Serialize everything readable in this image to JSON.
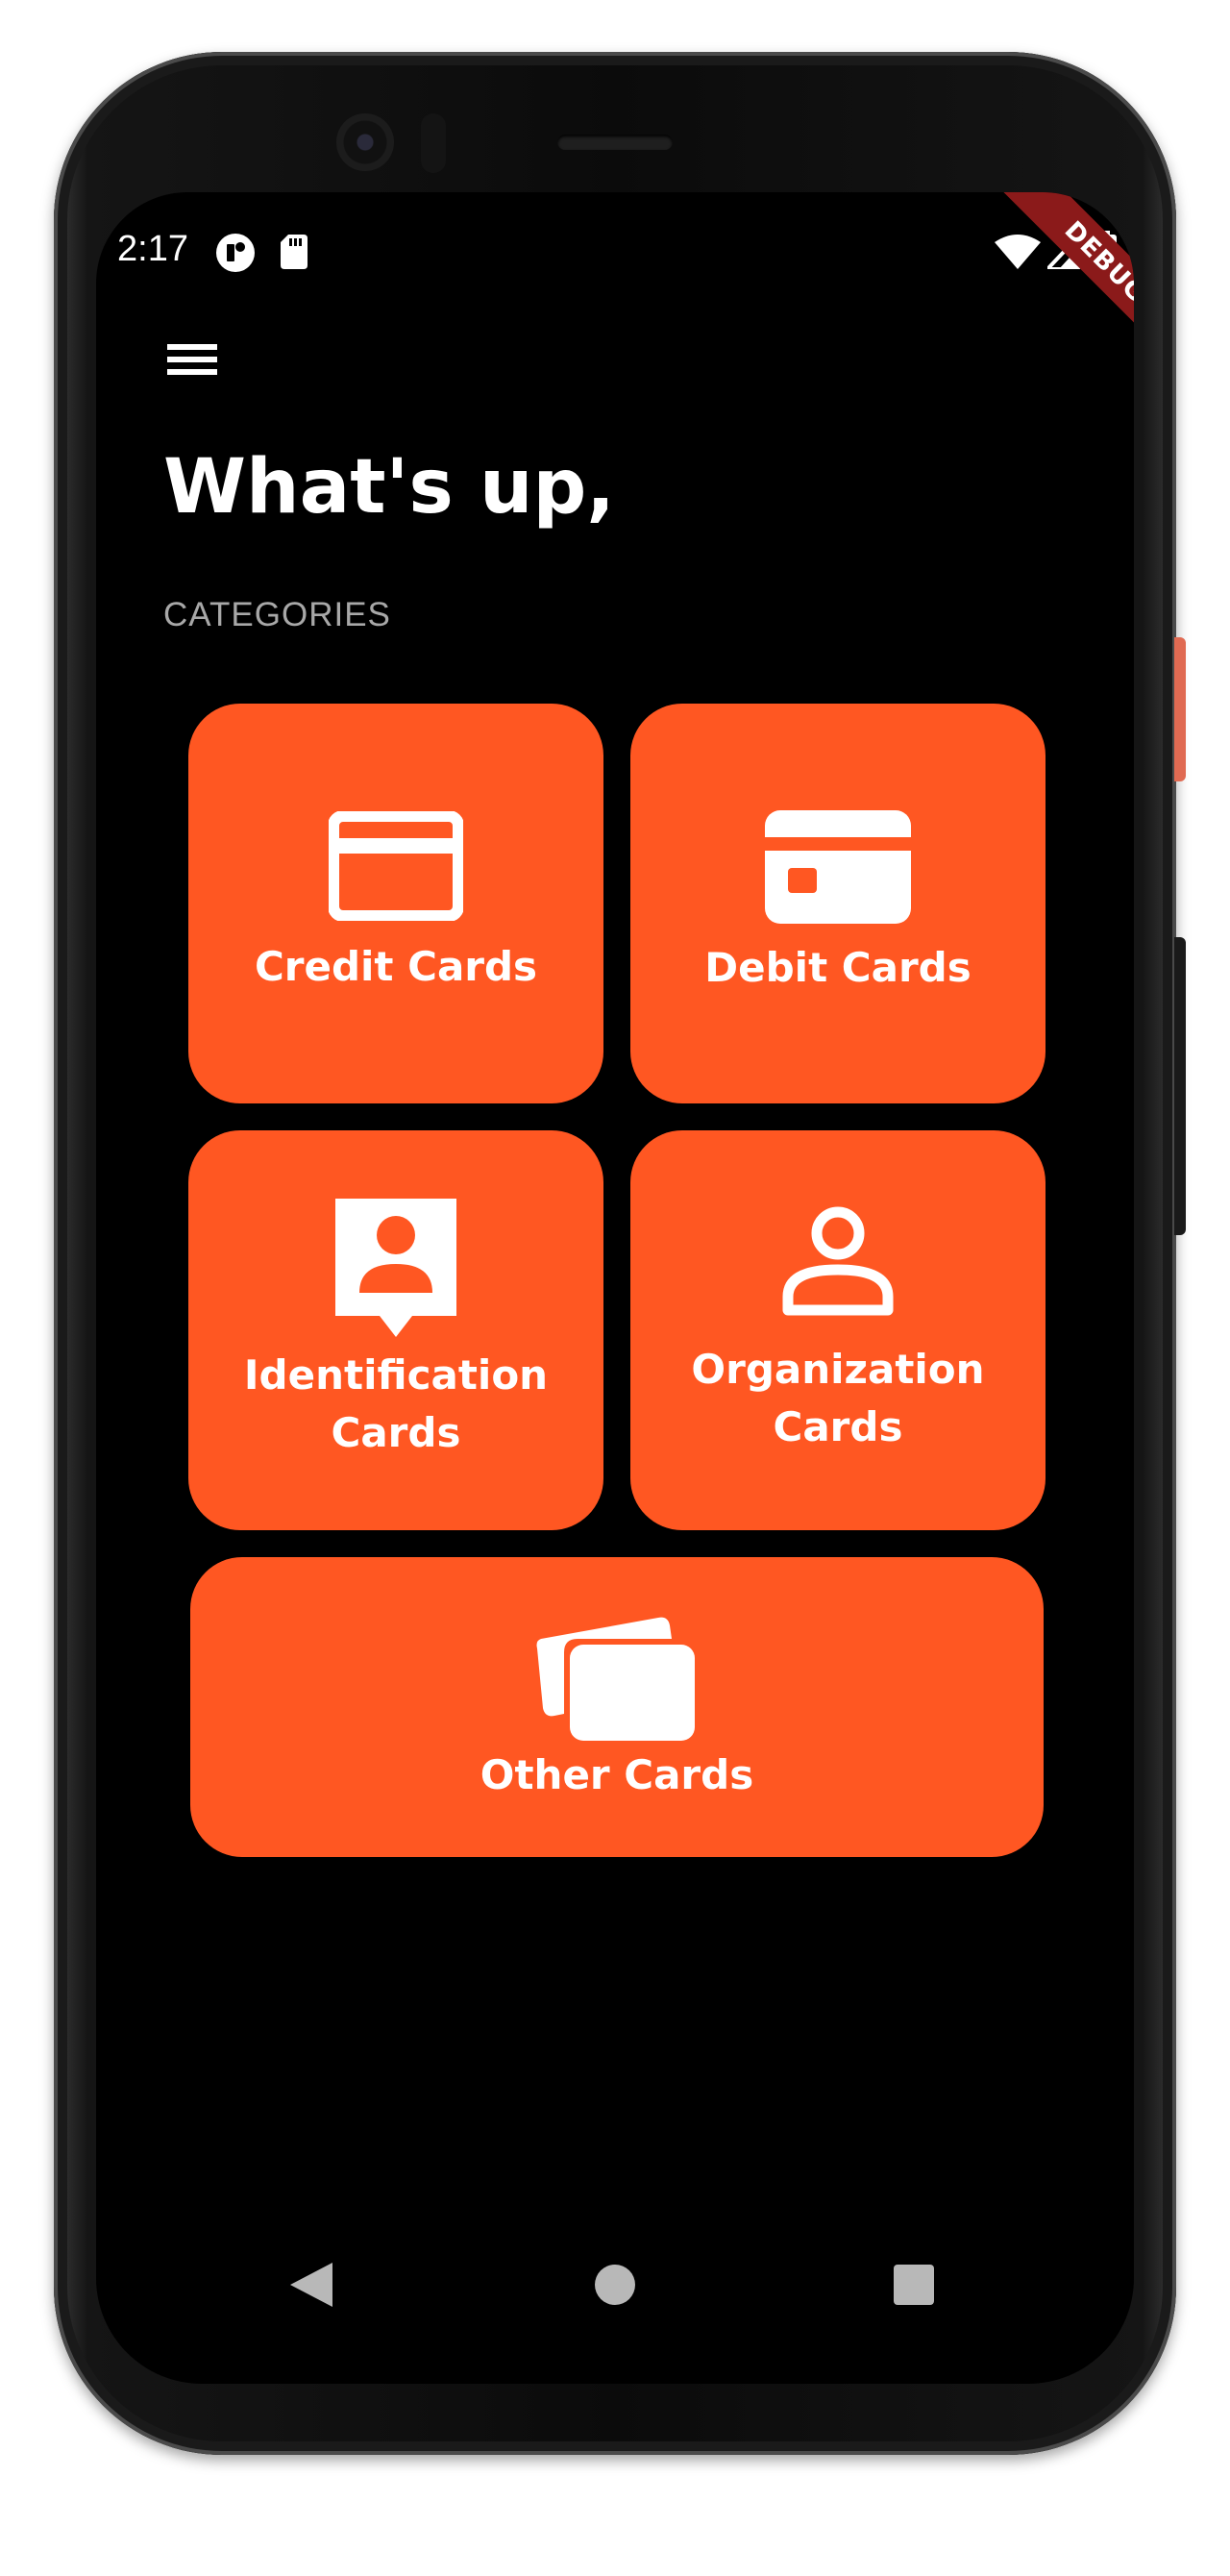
{
  "status_bar": {
    "time": "2:17",
    "left_icons": [
      "app-notification-icon",
      "sd-card-icon"
    ],
    "right_icons": [
      "wifi-icon",
      "cell-signal-icon",
      "battery-icon"
    ]
  },
  "debug_banner": "DEBUG",
  "app_bar": {
    "menu_icon": "hamburger-menu-icon"
  },
  "greeting": "What's up,",
  "section_label": "CATEGORIES",
  "categories": [
    {
      "label": "Credit Cards",
      "icon": "credit-card-icon"
    },
    {
      "label": "Debit Cards",
      "icon": "debit-card-icon"
    },
    {
      "label": "Identification\nCards",
      "icon": "id-card-icon"
    },
    {
      "label": "Organization\nCards",
      "icon": "person-icon"
    },
    {
      "label": "Other Cards",
      "icon": "cards-stack-icon"
    }
  ],
  "colors": {
    "background": "#000000",
    "accent": "#ff5722",
    "text": "#ffffff",
    "muted_text": "#a8a8a8",
    "debug_ribbon": "#8b1a1a"
  },
  "nav_bar": {
    "icons": [
      "back-icon",
      "home-icon",
      "recents-icon"
    ]
  }
}
